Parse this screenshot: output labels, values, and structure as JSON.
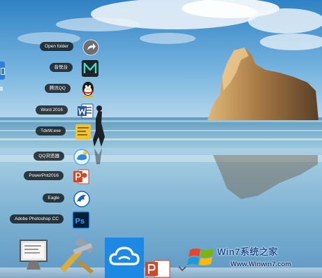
{
  "stack": {
    "items": [
      {
        "label": "Open folder",
        "icon": "arrow-circle-icon"
      },
      {
        "label": "音悦台",
        "icon": "yinyuetai-icon"
      },
      {
        "label": "腾讯QQ",
        "icon": "qq-penguin-icon"
      },
      {
        "label": "Word 2016",
        "icon": "word-icon"
      },
      {
        "label": "TdxW.exe",
        "icon": "tdxw-icon"
      },
      {
        "label": "QQ浏览器",
        "icon": "qq-browser-icon"
      },
      {
        "label": "PowerPnt2016",
        "icon": "powerpoint-icon"
      },
      {
        "label": "Eagle",
        "icon": "eagle-icon"
      },
      {
        "label": "Adobe Photoshop CC",
        "icon": "photoshop-icon"
      }
    ]
  },
  "dock": {
    "items": [
      {
        "name": "preview-monitor-icon"
      },
      {
        "name": "tools-hammer-icon"
      },
      {
        "name": "cloud-app-icon"
      },
      {
        "name": "powerpoint-dock-icon"
      },
      {
        "name": "chevron-down-icon"
      }
    ]
  },
  "watermark": {
    "brand": "Win7系统之家",
    "url": "Www.Winwin7.com"
  },
  "colors": {
    "word": "#2b579a",
    "powerpoint": "#d24726",
    "photoshop": "#31a8ff",
    "cloud": "#1e88e5"
  }
}
